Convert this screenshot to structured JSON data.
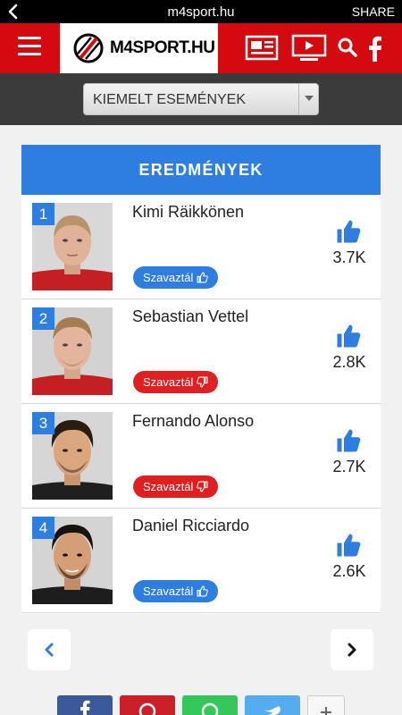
{
  "browser": {
    "url": "m4sport.hu",
    "share_label": "SHARE"
  },
  "header": {
    "logo_text": "M4SPORT.HU"
  },
  "filter": {
    "selected": "KIEMELT ESEMÉNYEK"
  },
  "results": {
    "title": "EREDMÉNYEK",
    "vote_label": "Szavaztál",
    "items": [
      {
        "rank": "1",
        "name": "Kimi Räikkönen",
        "count": "3.7K",
        "vote": "up"
      },
      {
        "rank": "2",
        "name": "Sebastian Vettel",
        "count": "2.8K",
        "vote": "down"
      },
      {
        "rank": "3",
        "name": "Fernando Alonso",
        "count": "2.7K",
        "vote": "down"
      },
      {
        "rank": "4",
        "name": "Daniel Ricciardo",
        "count": "2.6K",
        "vote": "up"
      }
    ]
  },
  "colors": {
    "brand_red": "#d40a0f",
    "accent_blue": "#2e7de1",
    "vote_down_red": "#e02020"
  },
  "share_buttons": [
    "facebook-icon",
    "pinterest-icon",
    "whatsapp-icon",
    "twitter-icon",
    "plus-icon"
  ]
}
